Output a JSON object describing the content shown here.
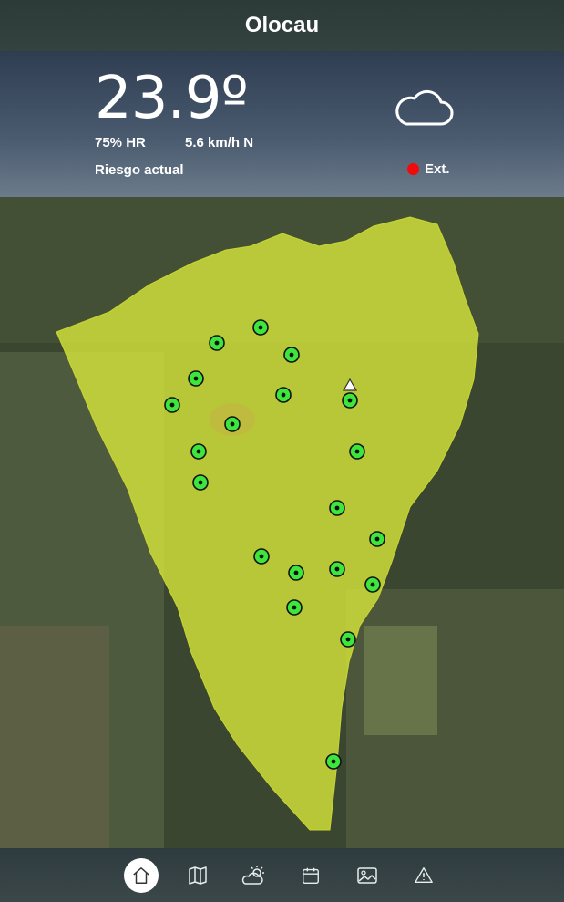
{
  "header": {
    "title": "Olocau"
  },
  "weather": {
    "temperature": "23.9º",
    "humidity": "75% HR",
    "wind": "5.6 km/h N",
    "risk_label": "Riesgo actual",
    "risk_level": "Ext.",
    "risk_color": "#f20a0a",
    "condition_icon": "cloud-icon"
  },
  "map": {
    "area_color": "#d4e43a",
    "point_color": "#3ce63c",
    "point_count": 22,
    "marker": "triangle-marker-icon"
  },
  "nav": {
    "items": [
      {
        "icon": "home-icon",
        "active": true
      },
      {
        "icon": "map-icon",
        "active": false
      },
      {
        "icon": "weather-icon",
        "active": false
      },
      {
        "icon": "calendar-icon",
        "active": false
      },
      {
        "icon": "gallery-icon",
        "active": false
      },
      {
        "icon": "alert-icon",
        "active": false
      }
    ]
  }
}
